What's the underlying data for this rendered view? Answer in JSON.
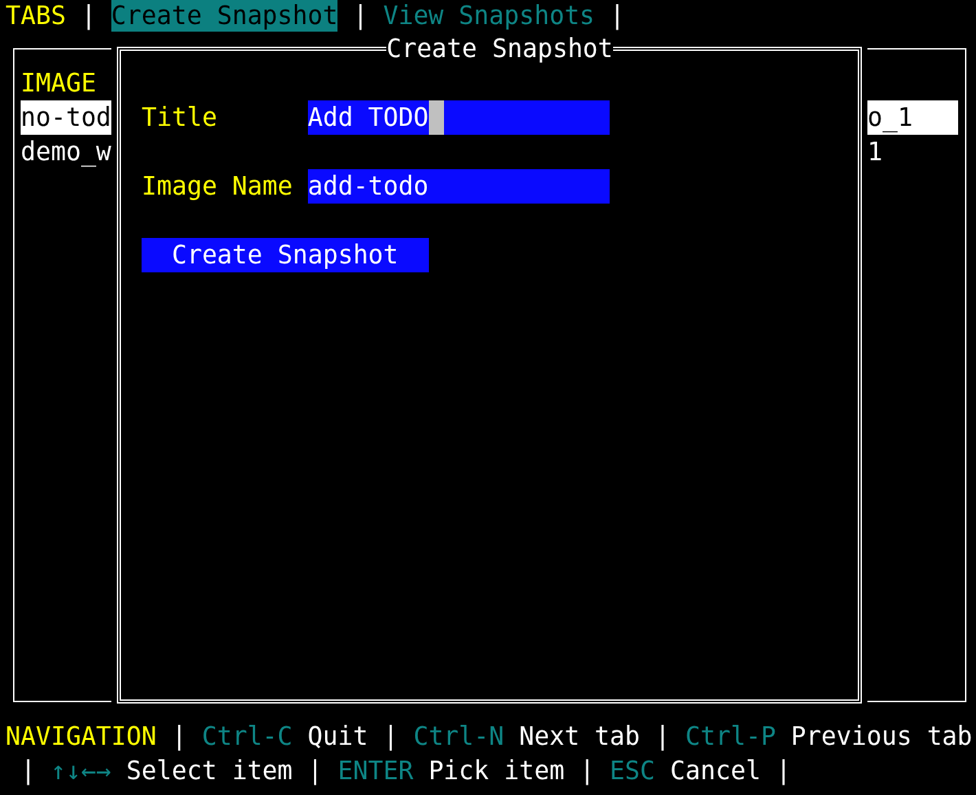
{
  "tab_bar": {
    "segments": [
      {
        "kind": "heading",
        "text": "TABS"
      },
      {
        "kind": "separator",
        "text": "|"
      },
      {
        "kind": "tab",
        "label": "Create Snapshot",
        "selected": true
      },
      {
        "kind": "separator",
        "text": "|"
      },
      {
        "kind": "tab",
        "label": "View Snapshots",
        "selected": false
      },
      {
        "kind": "separator",
        "text": "|"
      }
    ]
  },
  "table": {
    "columns": [
      "IMAGE"
    ],
    "rows": [
      {
        "cells": [
          "no-tod",
          "o_1"
        ],
        "selected": true
      },
      {
        "cells": [
          "demo_w",
          "1"
        ],
        "selected": false
      }
    ]
  },
  "dialog": {
    "title": "Create Snapshot",
    "fields": [
      {
        "label": "Title",
        "value": "Add TODO",
        "focused": true
      },
      {
        "label": "Image Name",
        "value": "add-todo",
        "focused": false
      }
    ],
    "button": "Create Snapshot"
  },
  "navigation": {
    "segments": [
      {
        "kind": "heading",
        "text": "NAVIGATION"
      },
      {
        "kind": "separator",
        "text": "|"
      },
      {
        "kind": "shortcut",
        "key": "Ctrl-C",
        "action": "Quit"
      },
      {
        "kind": "separator",
        "text": "|"
      },
      {
        "kind": "shortcut",
        "key": "Ctrl-N",
        "action": "Next tab"
      },
      {
        "kind": "separator",
        "text": "|"
      },
      {
        "kind": "shortcut",
        "key": "Ctrl-P",
        "action": "Previous tab"
      },
      {
        "kind": "separator",
        "text": "|"
      },
      {
        "kind": "shortcut",
        "key": "↑↓←→",
        "action": "Select item"
      },
      {
        "kind": "separator",
        "text": "|"
      },
      {
        "kind": "shortcut",
        "key": "ENTER",
        "action": "Pick item"
      },
      {
        "kind": "separator",
        "text": "|"
      },
      {
        "kind": "shortcut",
        "key": "ESC",
        "action": "Cancel"
      },
      {
        "kind": "separator",
        "text": "|"
      }
    ]
  }
}
